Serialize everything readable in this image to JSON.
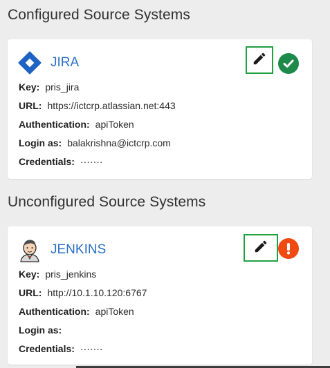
{
  "configured": {
    "title": "Configured Source Systems",
    "card": {
      "name": "JIRA",
      "status": "configured",
      "fields": [
        {
          "label": "Key:",
          "value": "pris_jira"
        },
        {
          "label": "URL:",
          "value": "https://ictcrp.atlassian.net:443"
        },
        {
          "label": "Authentication:",
          "value": "apiToken"
        },
        {
          "label": "Login as:",
          "value": "balakrishna@ictcrp.com"
        },
        {
          "label": "Credentials:",
          "value": "·······"
        }
      ]
    }
  },
  "unconfigured": {
    "title": "Unconfigured Source Systems",
    "card": {
      "name": "JENKINS",
      "status": "error",
      "fields": [
        {
          "label": "Key:",
          "value": "pris_jenkins"
        },
        {
          "label": "URL:",
          "value": "http://10.1.10.120:6767"
        },
        {
          "label": "Authentication:",
          "value": "apiToken"
        },
        {
          "label": "Login as:",
          "value": ""
        },
        {
          "label": "Credentials:",
          "value": "·······"
        }
      ]
    }
  },
  "icons": {
    "jira_logo": "jira-diamond-logo",
    "jenkins_logo": "jenkins-butler-logo",
    "edit": "pencil-icon",
    "ok": "check-circle-icon",
    "error": "exclamation-circle-icon"
  },
  "colors": {
    "link": "#2a6fc4",
    "highlight_border": "#21a040",
    "ok": "#1e8a4a",
    "error": "#f04a12",
    "background": "#ededed"
  }
}
